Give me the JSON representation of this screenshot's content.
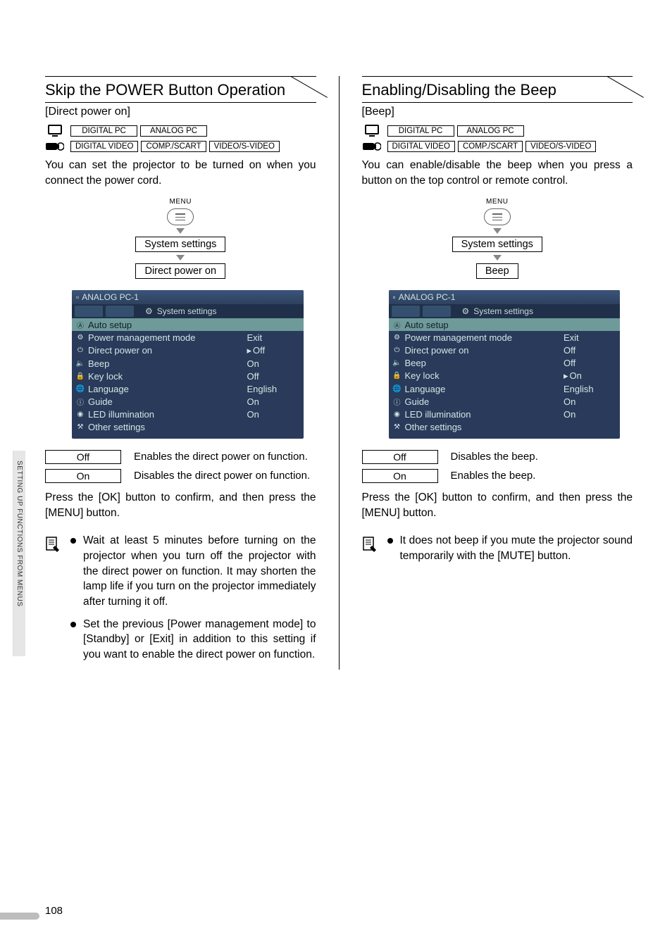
{
  "sideTab": "SETTING UP FUNCTIONS FROM MENUS",
  "pageNumber": "108",
  "left": {
    "title": "Skip the POWER Button Operation",
    "subhead": "[Direct power on]",
    "badgesTop": [
      "DIGITAL PC",
      "ANALOG PC"
    ],
    "badgesBottom": [
      "DIGITAL VIDEO",
      "COMP./SCART",
      "VIDEO/S-VIDEO"
    ],
    "intro": "You can set the projector to be turned on when you connect the power cord.",
    "flow": {
      "menuLabel": "MENU",
      "step1": "System settings",
      "step2": "Direct power on"
    },
    "osd": {
      "topLabel": "ANALOG PC-1",
      "tabsLabel": "System settings",
      "rows": [
        {
          "icon": "Ⓐ",
          "label": "Auto setup",
          "val": "",
          "hl": true,
          "caret": false
        },
        {
          "icon": "⚙",
          "label": "Power management mode",
          "val": "Exit",
          "hl": false,
          "caret": false
        },
        {
          "icon": "⏻",
          "label": "Direct power on",
          "val": "Off",
          "hl": false,
          "caret": true
        },
        {
          "icon": "🔈",
          "label": "Beep",
          "val": "On",
          "hl": false,
          "caret": false
        },
        {
          "icon": "🔒",
          "label": "Key lock",
          "val": "Off",
          "hl": false,
          "caret": false
        },
        {
          "icon": "🌐",
          "label": "Language",
          "val": "English",
          "hl": false,
          "caret": false
        },
        {
          "icon": "ⓘ",
          "label": "Guide",
          "val": "On",
          "hl": false,
          "caret": false
        },
        {
          "icon": "◉",
          "label": "LED illumination",
          "val": "On",
          "hl": false,
          "caret": false
        },
        {
          "icon": "⚒",
          "label": "Other settings",
          "val": "",
          "hl": false,
          "caret": false
        }
      ]
    },
    "options": [
      {
        "label": "Off",
        "desc": "Enables the direct power on function."
      },
      {
        "label": "On",
        "desc": "Disables the direct power on function."
      }
    ],
    "confirm": "Press the [OK] button to confirm, and then press the [MENU] button.",
    "notes": [
      "Wait at least 5 minutes before turning on the projector when you turn off the projector with the direct power on function. It may shorten the lamp life if you turn on the projector immediately after turning it off.",
      "Set the previous [Power management mode] to [Standby] or [Exit] in addition to this setting if you want to enable the direct power on function."
    ]
  },
  "right": {
    "title": "Enabling/Disabling the Beep",
    "subhead": "[Beep]",
    "badgesTop": [
      "DIGITAL PC",
      "ANALOG PC"
    ],
    "badgesBottom": [
      "DIGITAL VIDEO",
      "COMP./SCART",
      "VIDEO/S-VIDEO"
    ],
    "intro": "You can enable/disable the beep when you press a button on the top control or remote control.",
    "flow": {
      "menuLabel": "MENU",
      "step1": "System settings",
      "step2": "Beep"
    },
    "osd": {
      "topLabel": "ANALOG PC-1",
      "tabsLabel": "System settings",
      "rows": [
        {
          "icon": "Ⓐ",
          "label": "Auto setup",
          "val": "",
          "hl": true,
          "caret": false
        },
        {
          "icon": "⚙",
          "label": "Power management mode",
          "val": "Exit",
          "hl": false,
          "caret": false
        },
        {
          "icon": "⏻",
          "label": "Direct power on",
          "val": "Off",
          "hl": false,
          "caret": false
        },
        {
          "icon": "🔈",
          "label": "Beep",
          "val": "Off",
          "hl": false,
          "caret": false
        },
        {
          "icon": "🔒",
          "label": "Key lock",
          "val": "On",
          "hl": false,
          "caret": true
        },
        {
          "icon": "🌐",
          "label": "Language",
          "val": "English",
          "hl": false,
          "caret": false
        },
        {
          "icon": "ⓘ",
          "label": "Guide",
          "val": "On",
          "hl": false,
          "caret": false
        },
        {
          "icon": "◉",
          "label": "LED illumination",
          "val": "On",
          "hl": false,
          "caret": false
        },
        {
          "icon": "⚒",
          "label": "Other settings",
          "val": "",
          "hl": false,
          "caret": false
        }
      ]
    },
    "options": [
      {
        "label": "Off",
        "desc": "Disables the beep."
      },
      {
        "label": "On",
        "desc": "Enables the beep."
      }
    ],
    "confirm": "Press the [OK] button to confirm, and then press the [MENU] button.",
    "notes": [
      "It does not beep if you mute the projector sound temporarily with the [MUTE] button."
    ]
  }
}
